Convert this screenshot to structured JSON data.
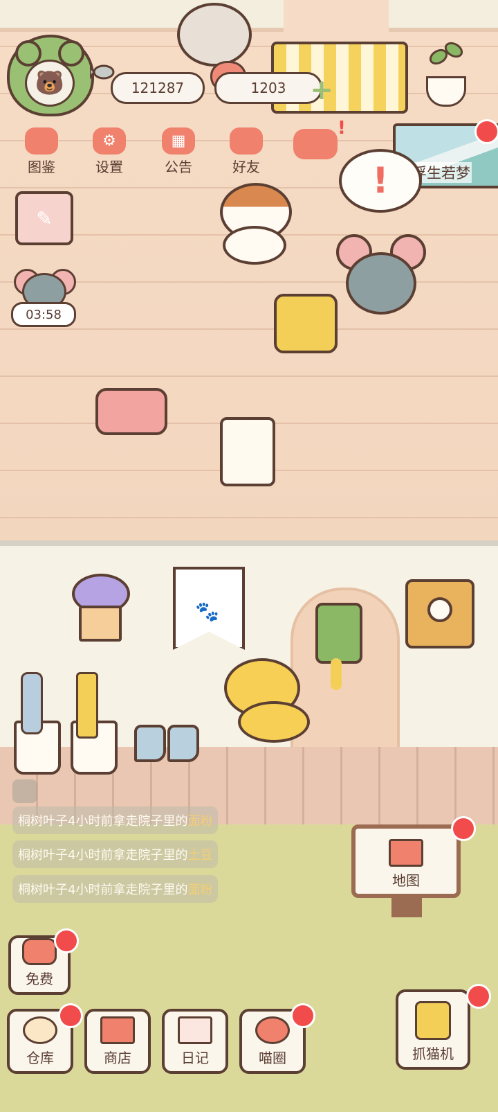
{
  "currency": {
    "coins": "121287",
    "hearts": "1203"
  },
  "menu": [
    {
      "label": "图鉴",
      "icon": "cat-book-icon"
    },
    {
      "label": "设置",
      "icon": "gear-icon"
    },
    {
      "label": "公告",
      "icon": "gift-icon"
    },
    {
      "label": "好友",
      "icon": "friends-icon"
    }
  ],
  "event_card": {
    "label": "浮生若梦"
  },
  "bubble": {
    "symbol": "!"
  },
  "timer": {
    "value": "03:58"
  },
  "feed": [
    {
      "prefix": "桐树叶子4小时前拿走院子里的",
      "item": "面粉"
    },
    {
      "prefix": "桐树叶子4小时前拿走院子里的",
      "item": "土豆"
    },
    {
      "prefix": "桐树叶子4小时前拿走院子里的",
      "item": "面粉"
    }
  ],
  "buttons": {
    "free": "免费",
    "map": "地图",
    "warehouse": "仓库",
    "shop": "商店",
    "diary": "日记",
    "meow_circle": "喵圈",
    "claw_machine": "抓猫机"
  },
  "colors": {
    "accent": "#f0816c",
    "notification": "#f24b4b",
    "outline": "#5c3f33",
    "grass": "#dbd99a"
  }
}
